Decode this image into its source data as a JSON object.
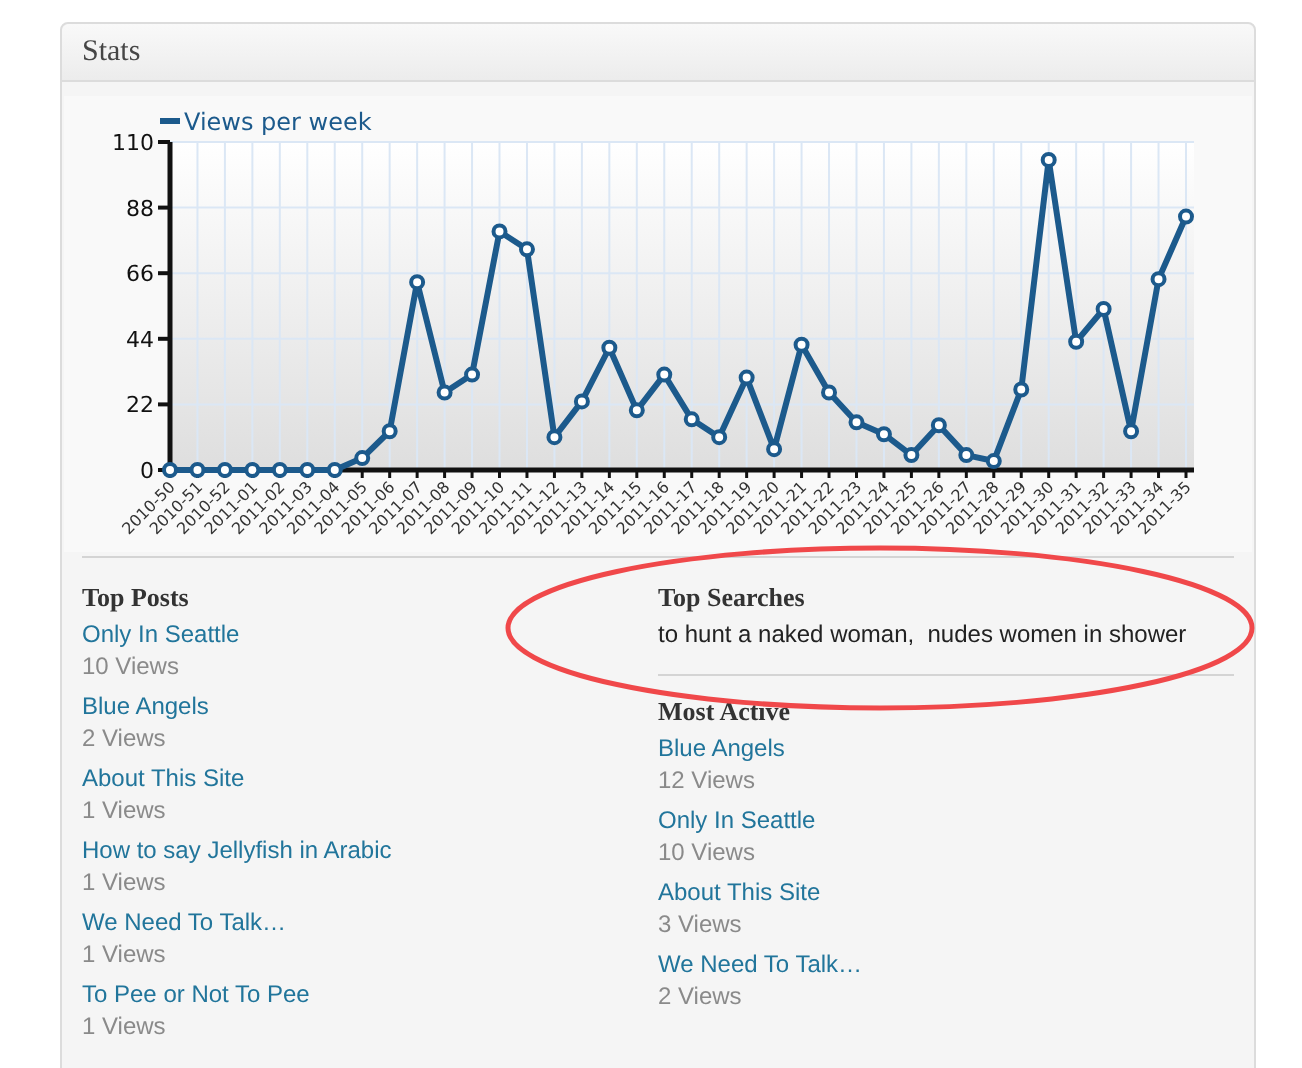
{
  "panel": {
    "title": "Stats"
  },
  "chart": {
    "chart_data": {
      "type": "line",
      "categories": [
        "2010-50",
        "2010-51",
        "2010-52",
        "2011-01",
        "2011-02",
        "2011-03",
        "2011-04",
        "2011-05",
        "2011-06",
        "2011-07",
        "2011-08",
        "2011-09",
        "2011-10",
        "2011-11",
        "2011-12",
        "2011-13",
        "2011-14",
        "2011-15",
        "2011-16",
        "2011-17",
        "2011-18",
        "2011-19",
        "2011-20",
        "2011-21",
        "2011-22",
        "2011-23",
        "2011-24",
        "2011-25",
        "2011-26",
        "2011-27",
        "2011-28",
        "2011-29",
        "2011-30",
        "2011-31",
        "2011-32",
        "2011-33",
        "2011-34",
        "2011-35"
      ],
      "grid": true,
      "series": [
        {
          "name": "Views per week",
          "color": "#1c5a8c",
          "marker": "circle",
          "values": [
            0,
            0,
            0,
            0,
            0,
            0,
            0,
            4,
            13,
            63,
            26,
            32,
            80,
            74,
            11,
            23,
            41,
            20,
            32,
            17,
            11,
            31,
            7,
            42,
            26,
            16,
            12,
            5,
            15,
            5,
            3,
            27,
            104,
            43,
            54,
            13,
            64,
            85
          ]
        }
      ],
      "ylim": [
        0,
        110
      ],
      "yticks": [
        0,
        22,
        44,
        66,
        88,
        110
      ]
    }
  },
  "top_posts": {
    "title": "Top Posts",
    "items": [
      {
        "title": "Only In Seattle",
        "views": "10 Views"
      },
      {
        "title": "Blue Angels",
        "views": "2 Views"
      },
      {
        "title": "About This Site",
        "views": "1 Views"
      },
      {
        "title": "How to say Jellyfish in Arabic",
        "views": "1 Views"
      },
      {
        "title": "We Need To Talk…",
        "views": "1 Views"
      },
      {
        "title": "To Pee or Not To Pee",
        "views": "1 Views"
      }
    ]
  },
  "top_searches": {
    "title": "Top Searches",
    "text": "to hunt a naked woman,  nudes women in shower"
  },
  "most_active": {
    "title": "Most Active",
    "items": [
      {
        "title": "Blue Angels",
        "views": "12 Views"
      },
      {
        "title": "Only In Seattle",
        "views": "10 Views"
      },
      {
        "title": "About This Site",
        "views": "3 Views"
      },
      {
        "title": "We Need To Talk…",
        "views": "2 Views"
      }
    ]
  }
}
